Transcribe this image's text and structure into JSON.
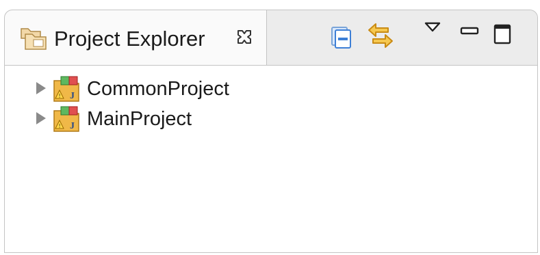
{
  "view": {
    "tab_title": "Project Explorer",
    "tab_icon": "project-explorer-icon",
    "close_icon": "close-icon"
  },
  "toolbar": {
    "items": [
      {
        "name": "collapse-all-icon",
        "tooltip": ""
      },
      {
        "name": "link-with-editor-icon",
        "tooltip": ""
      },
      {
        "name": "view-menu-icon",
        "tooltip": ""
      },
      {
        "name": "minimize-icon",
        "tooltip": ""
      },
      {
        "name": "maximize-icon",
        "tooltip": ""
      }
    ]
  },
  "tree": {
    "items": [
      {
        "label": "CommonProject",
        "icon": "project-icon",
        "expanded": false
      },
      {
        "label": "MainProject",
        "icon": "project-icon",
        "expanded": false
      }
    ]
  },
  "colors": {
    "tab_active_bg": "#fafafa",
    "tabbar_bg": "#ececec",
    "border": "#c4c4c4",
    "text": "#1a1a1a",
    "accent_blue": "#3d7fd6",
    "accent_orange": "#f0a830"
  }
}
